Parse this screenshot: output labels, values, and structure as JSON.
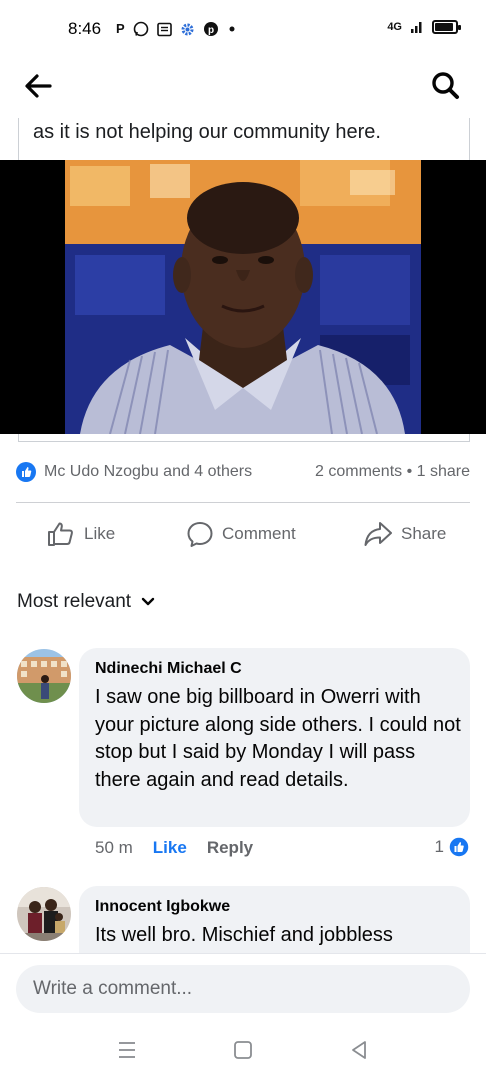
{
  "status_bar": {
    "time": "8:46",
    "icons": [
      "p-icon",
      "whatsapp-icon",
      "news-icon",
      "gear-icon",
      "pinterest-icon",
      "dot-icon"
    ],
    "network": "4G",
    "battery_level": 0.9
  },
  "header": {
    "back_icon": "back-arrow-icon",
    "search_icon": "search-icon"
  },
  "post": {
    "text_tail": "as it is not helping our community here."
  },
  "reactions": {
    "reactors": "Mc Udo Nzogbu and 4 others",
    "counts": "2 comments • 1 share"
  },
  "actions": {
    "like": "Like",
    "comment": "Comment",
    "share": "Share"
  },
  "sort": {
    "label": "Most relevant"
  },
  "comments": [
    {
      "name": "Ndinechi Michael C",
      "text": "I saw one big billboard in Owerri with your picture along side others. I could not stop but I said by Monday I will pass there again and read details.",
      "time": "50 m",
      "like": "Like",
      "reply": "Reply",
      "reaction_count": "1"
    },
    {
      "name": "Innocent Igbokwe",
      "text": "Its well bro. Mischief and jobbless"
    }
  ],
  "composer": {
    "placeholder": "Write a comment..."
  },
  "colors": {
    "accent": "#1877f2",
    "muted": "#65676b",
    "bubble": "#f0f2f5"
  }
}
